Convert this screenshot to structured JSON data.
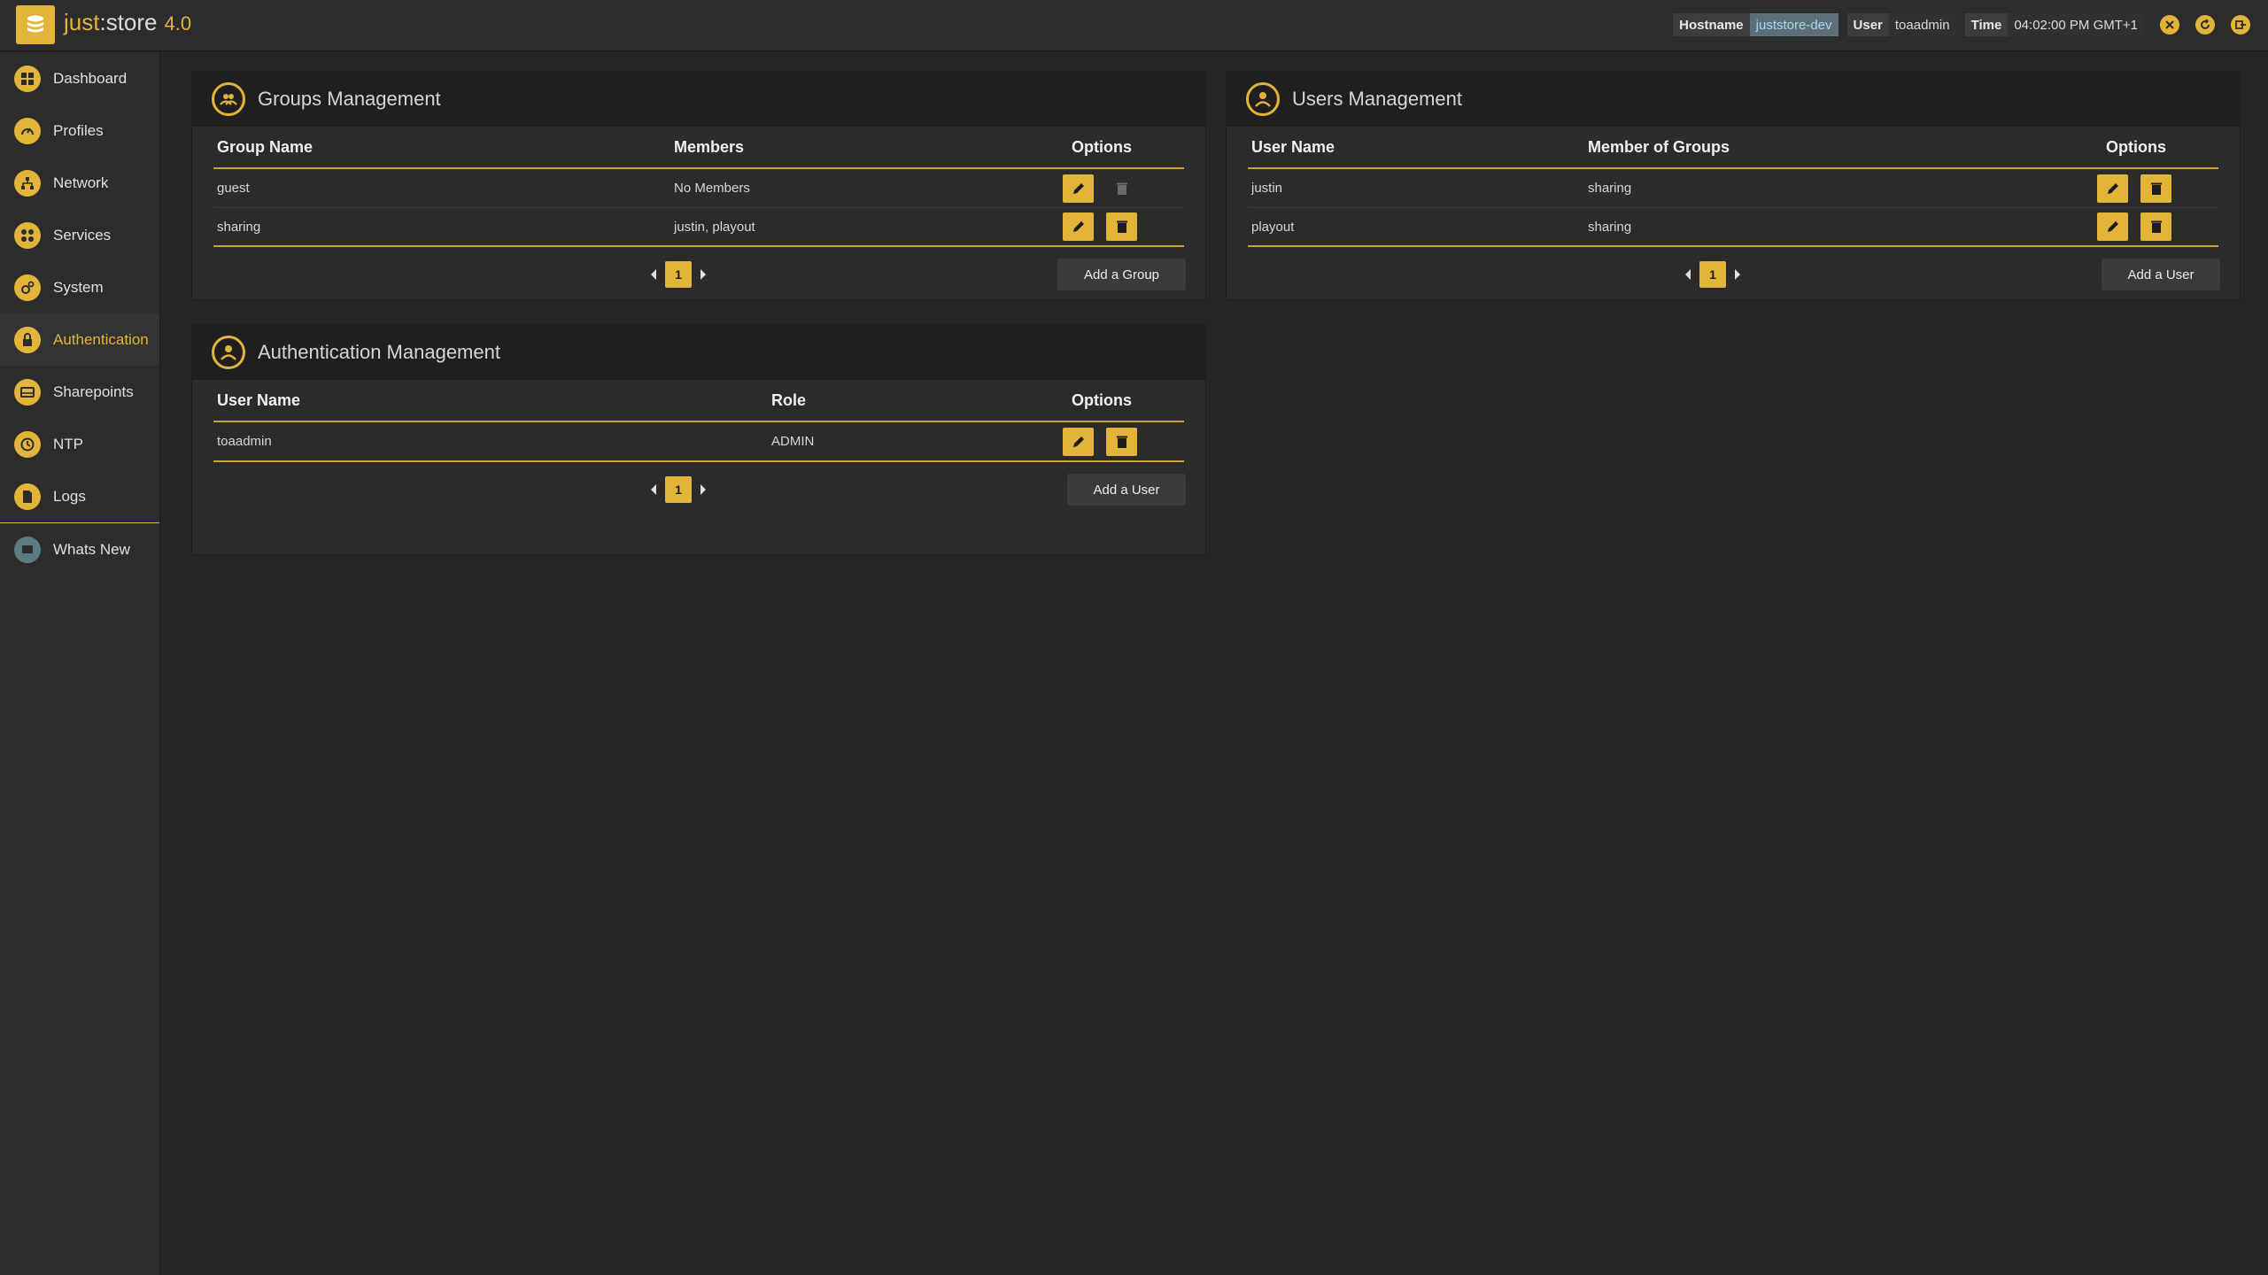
{
  "app": {
    "brand_prefix": "just",
    "brand_suffix": "store",
    "version": "4.0"
  },
  "status": {
    "hostname_label": "Hostname",
    "hostname_value": "juststore-dev",
    "user_label": "User",
    "user_value": "toaadmin",
    "time_label": "Time",
    "time_value": "04:02:00 PM GMT+1"
  },
  "sidebar": {
    "items": [
      {
        "label": "Dashboard",
        "icon": "dashboard-icon"
      },
      {
        "label": "Profiles",
        "icon": "gauge-icon"
      },
      {
        "label": "Network",
        "icon": "network-icon"
      },
      {
        "label": "Services",
        "icon": "services-icon"
      },
      {
        "label": "System",
        "icon": "gears-icon"
      },
      {
        "label": "Authentication",
        "icon": "lock-icon"
      },
      {
        "label": "Sharepoints",
        "icon": "drive-icon"
      },
      {
        "label": "NTP",
        "icon": "clock-icon"
      },
      {
        "label": "Logs",
        "icon": "file-icon"
      }
    ],
    "whats_new": "Whats New"
  },
  "groups": {
    "title": "Groups Management",
    "columns": [
      "Group Name",
      "Members",
      "Options"
    ],
    "rows": [
      {
        "name": "guest",
        "members": "No Members"
      },
      {
        "name": "sharing",
        "members": "justin, playout"
      }
    ],
    "page": "1",
    "add_label": "Add a Group"
  },
  "users": {
    "title": "Users Management",
    "columns": [
      "User Name",
      "Member of Groups",
      "Options"
    ],
    "rows": [
      {
        "name": "justin",
        "groups": "sharing"
      },
      {
        "name": "playout",
        "groups": "sharing"
      }
    ],
    "page": "1",
    "add_label": "Add a User"
  },
  "auth": {
    "title": "Authentication Management",
    "columns": [
      "User Name",
      "Role",
      "Options"
    ],
    "rows": [
      {
        "name": "toaadmin",
        "role": "ADMIN"
      }
    ],
    "page": "1",
    "add_label": "Add a User"
  },
  "colors": {
    "accent": "#e3b43a",
    "background": "#252525",
    "panel": "#2b2b2b",
    "header": "#1f1f1f"
  }
}
